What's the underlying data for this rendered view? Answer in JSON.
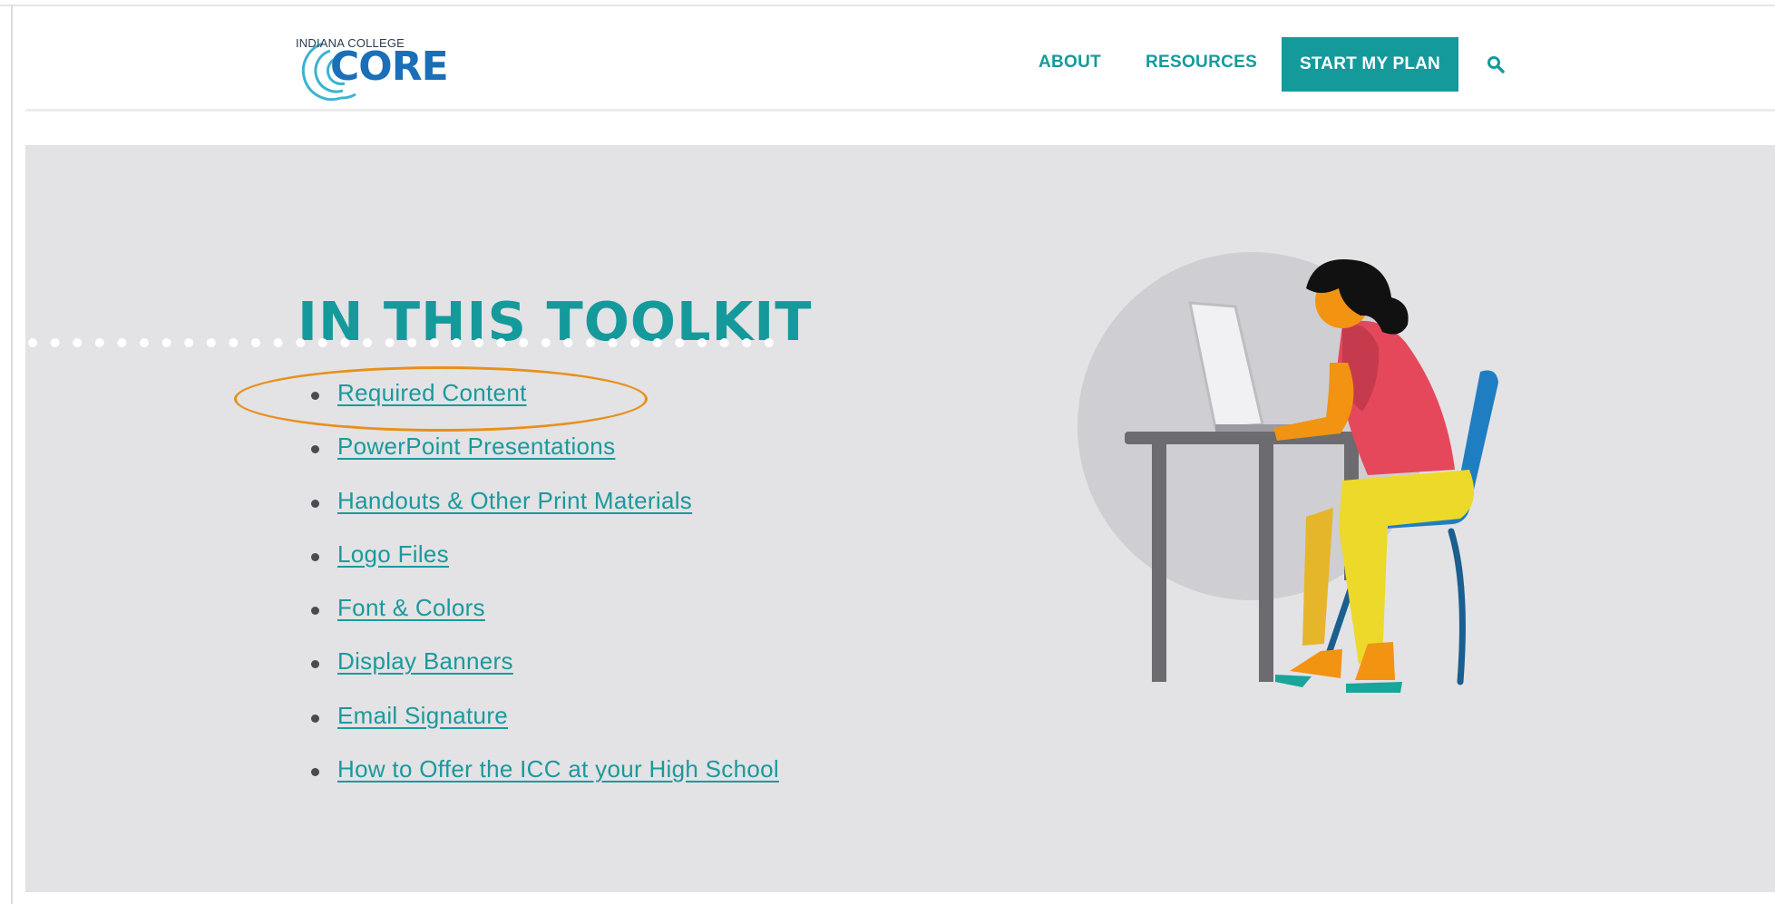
{
  "header": {
    "logo": {
      "small_text": "INDIANA COLLEGE",
      "main_text": "CORE"
    },
    "nav": [
      {
        "label": "ABOUT"
      },
      {
        "label": "RESOURCES"
      }
    ],
    "cta_label": "START MY PLAN",
    "search_icon": "search-icon"
  },
  "toolkit": {
    "title": "IN THIS TOOLKIT",
    "items": [
      {
        "label": "Required Content"
      },
      {
        "label": "PowerPoint Presentations"
      },
      {
        "label": "Handouts & Other Print Materials"
      },
      {
        "label": "Logo Files"
      },
      {
        "label": "Font & Colors"
      },
      {
        "label": "Display Banners"
      },
      {
        "label": "Email Signature"
      },
      {
        "label": "How to Offer the ICC at your High School"
      }
    ],
    "highlighted_item": "Required Content"
  },
  "colors": {
    "brand_teal": "#159a9c",
    "band_background": "#e3e2e5",
    "highlight_orange": "#e8901a",
    "logo_blue": "#1a6fb8"
  },
  "illustration": {
    "subject": "woman-at-laptop-illustration"
  }
}
